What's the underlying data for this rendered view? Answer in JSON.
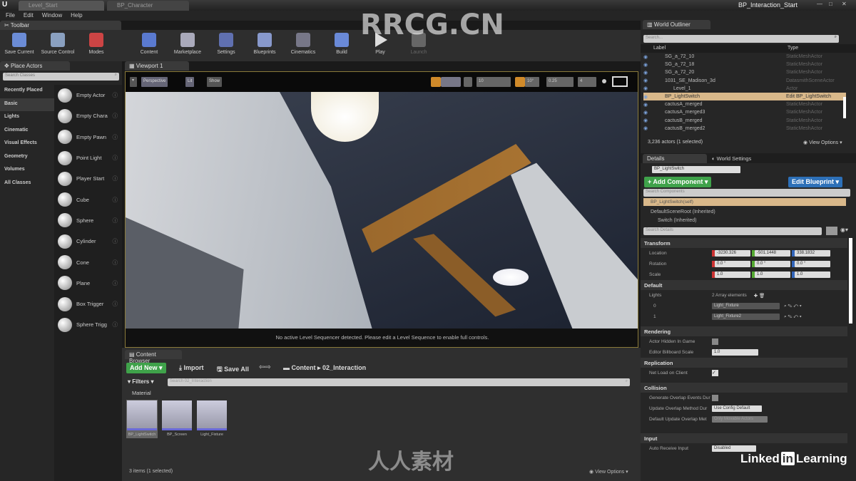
{
  "window": {
    "tabs": [
      "Level_Start",
      "BP_Character"
    ],
    "title": "BP_Interaction_Start",
    "controls": [
      "—",
      "□",
      "✕"
    ]
  },
  "menu": [
    "File",
    "Edit",
    "Window",
    "Help"
  ],
  "toolbar": {
    "tab": "Toolbar",
    "buttons": [
      "Save Current",
      "Source Control",
      "Modes",
      "Content",
      "Marketplace",
      "Settings",
      "Blueprints",
      "Cinematics",
      "Build",
      "Play",
      "Launch"
    ],
    "colors": [
      "#6b8cd6",
      "#8aa0c0",
      "#c44",
      "#5a7ad0",
      "#aab",
      "#6070b0",
      "#8899cc",
      "#778",
      "#6a8ad8",
      "#ddd",
      "#666"
    ]
  },
  "place_actors": {
    "tab": "Place Actors",
    "search_placeholder": "Search Classes",
    "categories": [
      "Recently Placed",
      "Basic",
      "Lights",
      "Cinematic",
      "Visual Effects",
      "Geometry",
      "Volumes",
      "All Classes"
    ],
    "selected_category": "Basic",
    "actors": [
      "Empty Actor",
      "Empty Chara",
      "Empty Pawn",
      "Point Light",
      "Player Start",
      "Cube",
      "Sphere",
      "Cylinder",
      "Cone",
      "Plane",
      "Box Trigger",
      "Sphere Trigg"
    ]
  },
  "viewport": {
    "tab": "Viewport 1",
    "view_mode": "Perspective",
    "lit": "Lit",
    "show": "Show",
    "grid_snap": "10",
    "rot_snap": "10°",
    "scale_snap": "0.25",
    "cam_speed": "4",
    "message": "No active Level Sequencer detected. Please edit a Level Sequence to enable full controls."
  },
  "content_browser": {
    "tab": "Content Browser",
    "add_new": "Add New",
    "import": "Import",
    "save_all": "Save All",
    "path": [
      "Content",
      "02_Interaction"
    ],
    "filters": "Filters",
    "search_placeholder": "Search 02_Interaction",
    "group": "Material",
    "assets": [
      "BP_LightSwitch",
      "BP_Screen",
      "Light_Fixture"
    ],
    "status": "3 items (1 selected)",
    "view_options": "View Options"
  },
  "outliner": {
    "tab": "World Outliner",
    "search_placeholder": "Search...",
    "col_label": "Label",
    "col_type": "Type",
    "rows": [
      {
        "label": "SG_a_72_10",
        "type": "StaticMeshActor"
      },
      {
        "label": "SG_a_72_18",
        "type": "StaticMeshActor"
      },
      {
        "label": "SG_a_72_20",
        "type": "StaticMeshActor"
      },
      {
        "label": "1031_SE_Madison_3d",
        "type": "DatasmithSceneActor"
      },
      {
        "label": "Level_1",
        "type": "Actor"
      },
      {
        "label": "BP_LightSwitch",
        "type": "Edit BP_LightSwitch",
        "selected": true
      },
      {
        "label": "cactusA_merged",
        "type": "StaticMeshActor"
      },
      {
        "label": "cactusA_merged3",
        "type": "StaticMeshActor"
      },
      {
        "label": "cactusB_merged",
        "type": "StaticMeshActor"
      },
      {
        "label": "cactusB_merged2",
        "type": "StaticMeshActor"
      }
    ],
    "status": "3,236 actors (1 selected)",
    "view_options": "View Options"
  },
  "details": {
    "tab": "Details",
    "tab2": "World Settings",
    "name": "BP_LightSwitch",
    "add_component": "+ Add Component",
    "edit_blueprint": "Edit Blueprint",
    "search_components": "Search Components",
    "self": "BP_LightSwitch(self)",
    "components": [
      "DefaultSceneRoot (Inherited)",
      "Switch (Inherited)"
    ],
    "search_details": "Search Details",
    "transform": {
      "title": "Transform",
      "location_label": "Location",
      "rotation_label": "Rotation",
      "scale_label": "Scale",
      "location": [
        "-3230.326",
        "-501.1448",
        "338.1832"
      ],
      "rotation": [
        "0.0 °",
        "0.0 °",
        "0.0 °"
      ],
      "scale": [
        "1.0",
        "1.0",
        "1.0"
      ]
    },
    "default": {
      "title": "Default",
      "lights_label": "Lights",
      "lights_count": "2 Array elements",
      "items": [
        {
          "index": "0",
          "value": "Light_Fixture"
        },
        {
          "index": "1",
          "value": "Light_Fixture2"
        }
      ]
    },
    "rendering": {
      "title": "Rendering",
      "hidden_label": "Actor Hidden In Game",
      "billboard_label": "Editor Billboard Scale",
      "billboard": "1.0"
    },
    "replication": {
      "title": "Replication",
      "net_load_label": "Net Load on Client"
    },
    "collision": {
      "title": "Collision",
      "gen_overlap": "Generate Overlap Events Dur",
      "update_overlap": "Update Overlap Method Dur",
      "update_value": "Use Config Default",
      "default_update": "Default Update Overlap Met",
      "default_value": "Only Movable Actors"
    },
    "input": {
      "title": "Input",
      "auto_receive": "Auto Receive Input",
      "auto_value": "Disabled"
    }
  },
  "watermarks": {
    "top": "RRCG.CN",
    "center": "人人素材",
    "brand": "Linked in Learning"
  }
}
